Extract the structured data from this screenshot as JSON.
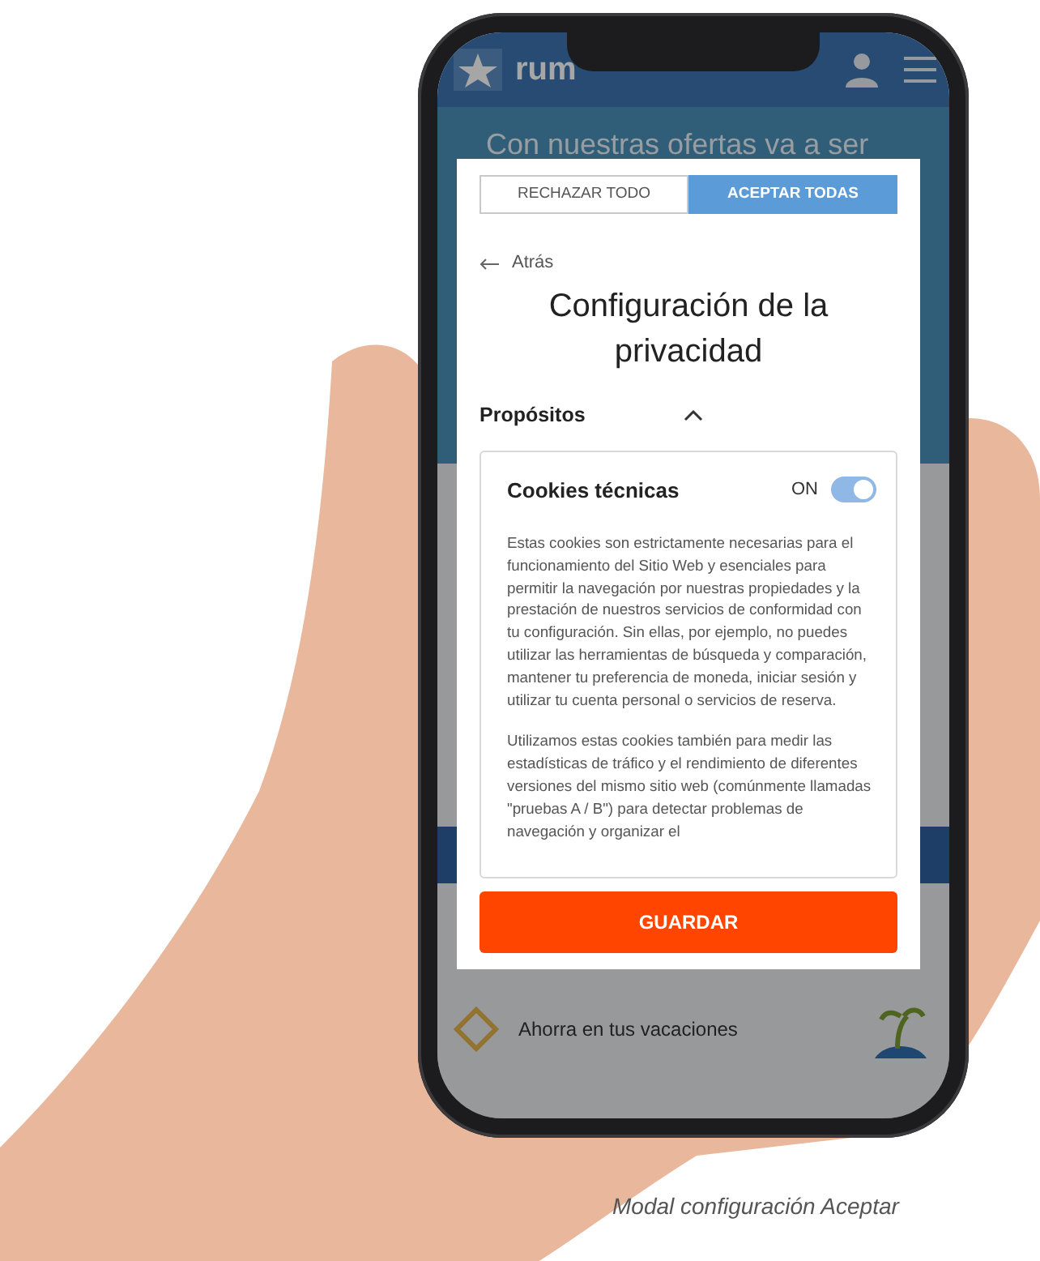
{
  "site": {
    "logo_text": "rum",
    "hero_text": "Con nuestras ofertas va a ser",
    "promo_text": "Ahorra en tus vacaciones"
  },
  "modal": {
    "consent_buttons": [
      {
        "label": "RECHAZAR TODO",
        "selected": false
      },
      {
        "label": "ACEPTAR TODAS",
        "selected": true
      }
    ],
    "back_link": "Atrás",
    "title": "Configuración de la privacidad",
    "section": {
      "label": "Propósitos",
      "expanded": true
    },
    "cookie_card": {
      "title": "Cookies técnicas",
      "toggle_label": "ON",
      "on": true,
      "paragraphs": [
        "Estas cookies son estrictamente necesarias para el funcionamiento del Sitio Web y esenciales para permitir la navegación por nuestras propiedades y la prestación de nuestros servicios de conformidad con tu configuración. Sin ellas, por ejemplo, no puedes utilizar las herramientas de búsqueda y comparación, mantener tu preferencia de moneda, iniciar sesión y utilizar tu cuenta personal o servicios de reserva.",
        "Utilizamos estas cookies también para medir las estadísticas de tráfico y el rendimiento de diferentes versiones del mismo sitio web (comúnmente llamadas \"pruebas A / B\") para detectar problemas de navegación y organizar el"
      ]
    },
    "save_button": "GUARDAR"
  },
  "caption": "Modal configuración Aceptar"
}
